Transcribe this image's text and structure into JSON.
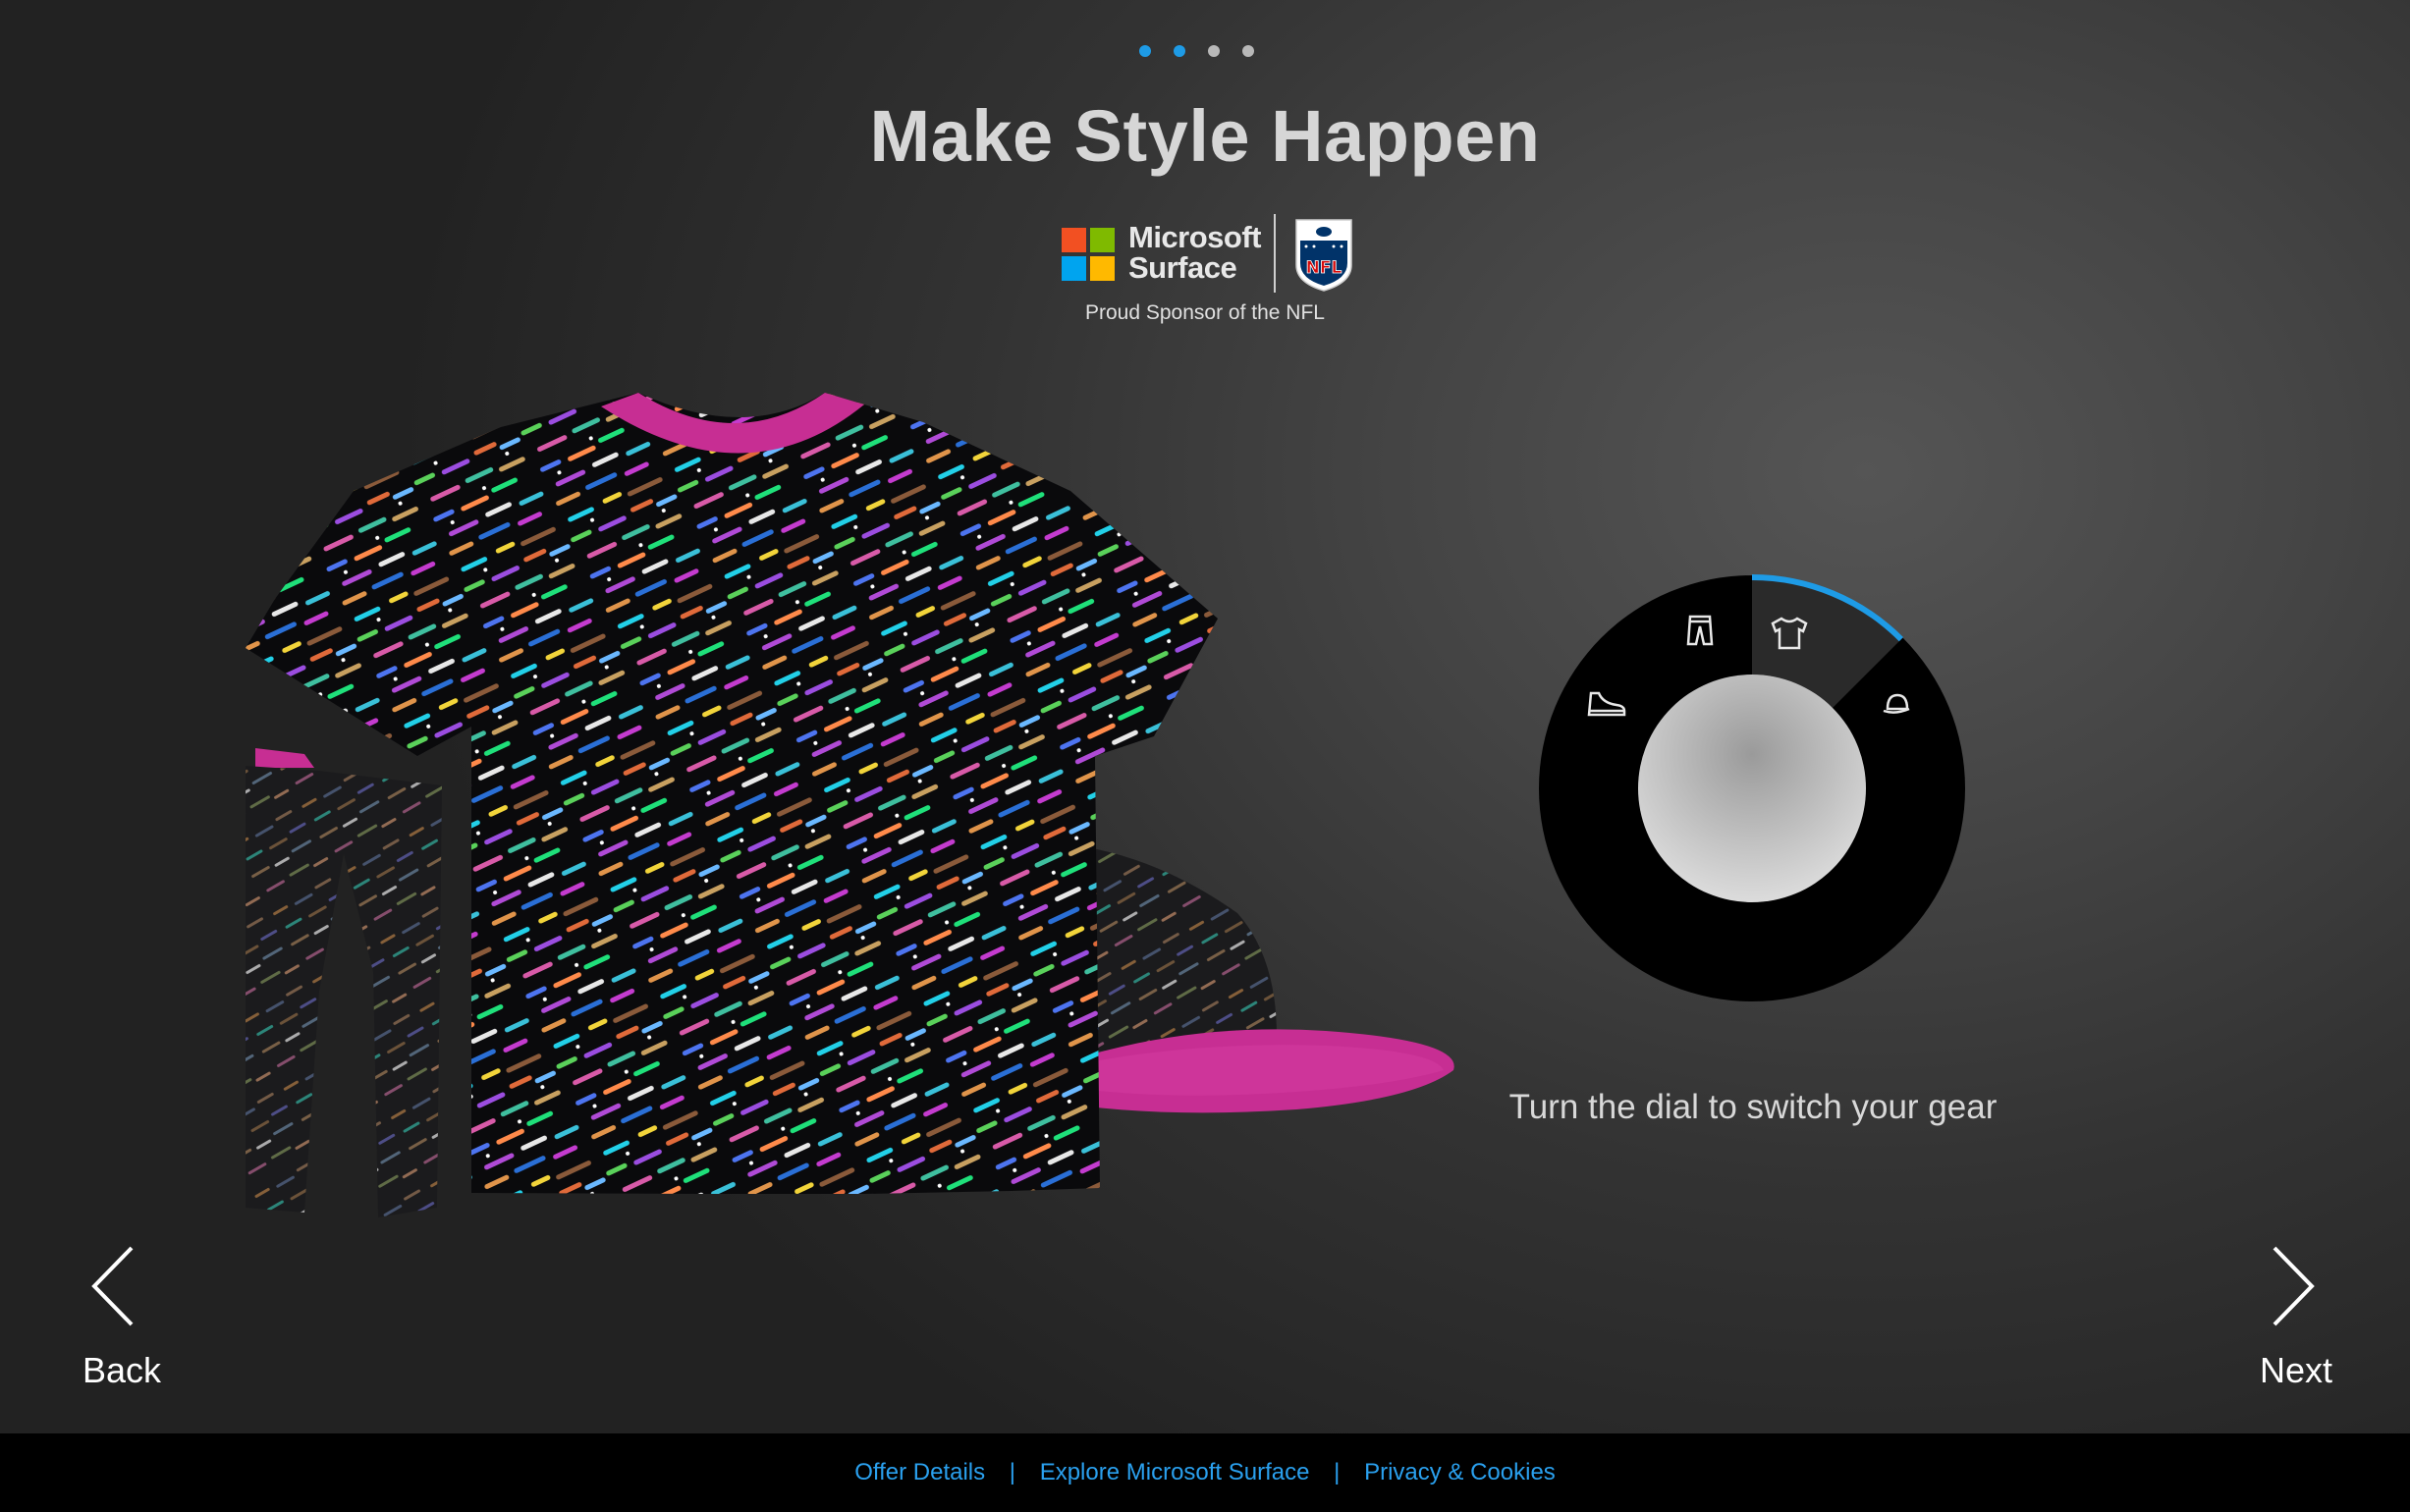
{
  "progress": {
    "total_steps": 4,
    "active_steps": 2,
    "active_color": "#1e9be6",
    "inactive_color": "#b8b8b8"
  },
  "header": {
    "title": "Make Style Happen"
  },
  "sponsor": {
    "brand_line1": "Microsoft",
    "brand_line2": "Surface",
    "nfl_text": "NFL",
    "caption": "Proud Sponsor of the NFL",
    "logo_colors": [
      "#f25022",
      "#7fba00",
      "#00a4ef",
      "#ffb900"
    ]
  },
  "gear": {
    "items": [
      "shirt",
      "pants",
      "cap"
    ],
    "accent_color": "#c72e93"
  },
  "dial": {
    "caption": "Turn the dial to switch your gear",
    "selected": "shirt",
    "segments": [
      {
        "name": "shoe-icon"
      },
      {
        "name": "pants-icon"
      },
      {
        "name": "shirt-icon"
      },
      {
        "name": "cap-icon"
      }
    ],
    "accent_color": "#1e9be6"
  },
  "nav": {
    "back_label": "Back",
    "next_label": "Next"
  },
  "footer": {
    "links": [
      "Offer Details",
      "Explore Microsoft Surface",
      "Privacy & Cookies"
    ],
    "separator": "|"
  }
}
